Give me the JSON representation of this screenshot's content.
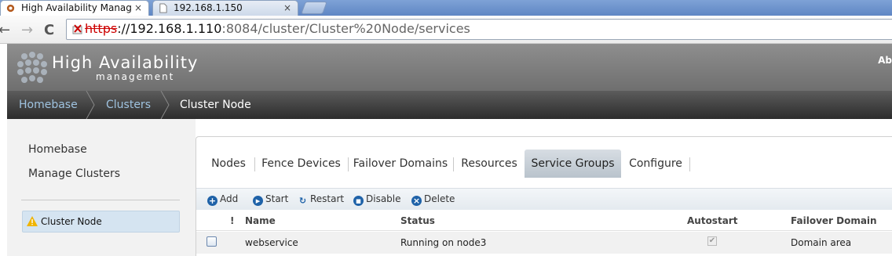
{
  "browser": {
    "tabs": [
      {
        "title": "High Availability Manag",
        "close": "×"
      },
      {
        "title": "192.168.1.150",
        "close": "×"
      }
    ],
    "nav": {
      "back": "←",
      "forward": "→",
      "reload": "C"
    },
    "url": {
      "protocol": "https",
      "host": "://192.168.1.110",
      "path": ":8084/cluster/Cluster%20Node/services"
    }
  },
  "header": {
    "title": "High Availability",
    "subtitle": "management",
    "right_text": "Ab"
  },
  "breadcrumb": [
    "Homebase",
    "Clusters",
    "Cluster Node"
  ],
  "leftnav": {
    "items": [
      "Homebase",
      "Manage Clusters"
    ],
    "selected": "Cluster Node"
  },
  "tabs": [
    "Nodes",
    "Fence Devices",
    "Failover Domains",
    "Resources",
    "Service Groups",
    "Configure"
  ],
  "selected_tab": "Service Groups",
  "actions": [
    {
      "label": "Add",
      "icon": "+"
    },
    {
      "label": "Start",
      "icon": "▸"
    },
    {
      "label": "Restart",
      "icon": "↻"
    },
    {
      "label": "Disable",
      "icon": "▪"
    },
    {
      "label": "Delete",
      "icon": "×"
    }
  ],
  "table": {
    "columns": {
      "flag": "!",
      "name": "Name",
      "status": "Status",
      "autostart": "Autostart",
      "failover": "Failover Domain"
    },
    "rows": [
      {
        "name": "webservice",
        "status": "Running on node3",
        "autostart": "✔",
        "failover": "Domain area"
      }
    ]
  }
}
